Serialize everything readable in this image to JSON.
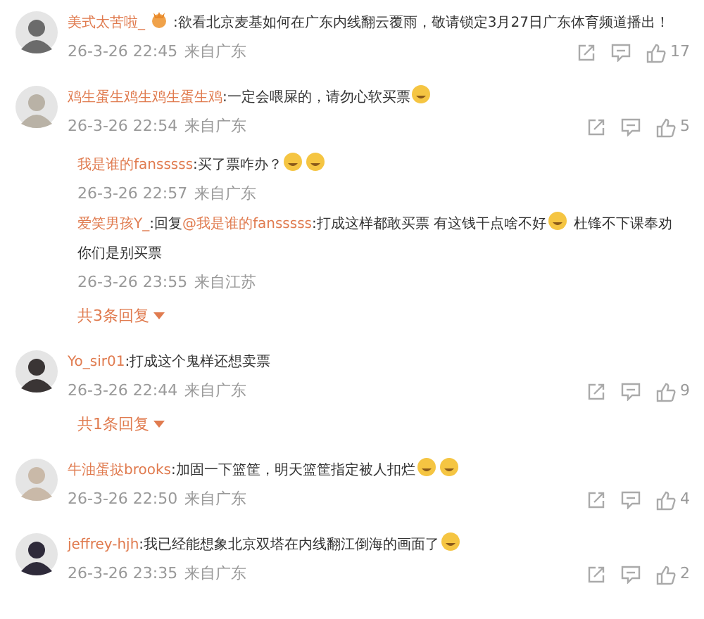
{
  "comments": [
    {
      "parts": [
        {
          "kind": "name",
          "text": "美式太苦啦_"
        },
        {
          "kind": "badge"
        },
        {
          "kind": "text",
          "text": ":欲看北京麦基如何在广东内线翻云覆雨，敬请锁定3月27日广东体育频道播出！"
        }
      ],
      "time": "26-3-26 22:45",
      "source": "来自广东",
      "likes": "17"
    },
    {
      "parts": [
        {
          "kind": "name",
          "text": "鸡生蛋生鸡生鸡生蛋生鸡"
        },
        {
          "kind": "text",
          "text": ":一定会喂屎的，请勿心软买票"
        },
        {
          "kind": "emoji"
        }
      ],
      "time": "26-3-26 22:54",
      "source": "来自广东",
      "likes": "5",
      "replies": [
        {
          "parts": [
            {
              "kind": "name",
              "text": "我是谁的fansssss"
            },
            {
              "kind": "text",
              "text": ":买了票咋办？"
            },
            {
              "kind": "emoji"
            },
            {
              "kind": "emoji"
            }
          ],
          "time": "26-3-26 22:57",
          "source": "来自广东"
        },
        {
          "parts": [
            {
              "kind": "name",
              "text": "爱笑男孩Y_"
            },
            {
              "kind": "text",
              "text": ":回复"
            },
            {
              "kind": "name",
              "text": "@我是谁的fansssss"
            },
            {
              "kind": "text",
              "text": ":打成这样都敢买票 有这钱干点啥不好"
            },
            {
              "kind": "emoji"
            },
            {
              "kind": "text",
              "text": " 杜锋不下课奉劝"
            },
            {
              "kind": "text",
              "text": "你们是别买票"
            }
          ],
          "time": "26-3-26 23:55",
          "source": "来自江苏"
        }
      ],
      "more_replies": "共3条回复"
    },
    {
      "parts": [
        {
          "kind": "name",
          "text": "Yo_sir01"
        },
        {
          "kind": "text",
          "text": ":打成这个鬼样还想卖票"
        }
      ],
      "time": "26-3-26 22:44",
      "source": "来自广东",
      "likes": "9",
      "more_replies": "共1条回复"
    },
    {
      "parts": [
        {
          "kind": "name",
          "text": "牛油蛋挞brooks"
        },
        {
          "kind": "text",
          "text": ":加固一下篮筐，明天篮筐指定被人扣烂"
        },
        {
          "kind": "emoji"
        },
        {
          "kind": "emoji"
        }
      ],
      "time": "26-3-26 22:50",
      "source": "来自广东",
      "likes": "4"
    },
    {
      "parts": [
        {
          "kind": "name",
          "text": "jeffrey-hjh"
        },
        {
          "kind": "text",
          "text": ":我已经能想象北京双塔在内线翻江倒海的画面了"
        },
        {
          "kind": "emoji"
        }
      ],
      "time": "26-3-26 23:35",
      "source": "来自广东",
      "likes": "2"
    }
  ]
}
